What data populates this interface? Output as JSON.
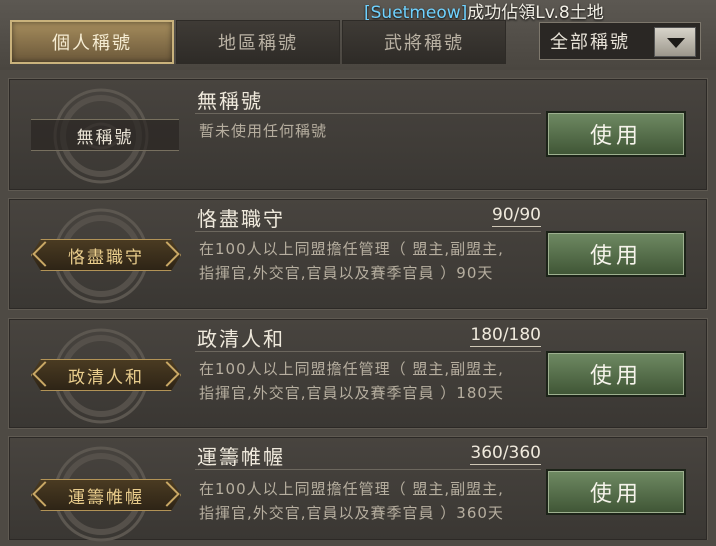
{
  "notice": {
    "user": "[Suetmeow]",
    "message": "成功佔領Lv.8土地"
  },
  "tabs": [
    {
      "label": "個人稱號",
      "active": true
    },
    {
      "label": "地區稱號",
      "active": false
    },
    {
      "label": "武將稱號",
      "active": false
    }
  ],
  "filter": {
    "selected": "全部稱號"
  },
  "titles": [
    {
      "plate": "無稱號",
      "name": "無稱號",
      "progress": "",
      "description": "暫未使用任何稱號",
      "button": "使用"
    },
    {
      "plate": "恪盡職守",
      "name": "恪盡職守",
      "progress": "90/90",
      "description": "在100人以上同盟擔任管理（ 盟主,副盟主,指揮官,外交官,官員以及賽季官員 ）90天",
      "button": "使用"
    },
    {
      "plate": "政清人和",
      "name": "政清人和",
      "progress": "180/180",
      "description": "在100人以上同盟擔任管理（ 盟主,副盟主,指揮官,外交官,官員以及賽季官員 ）180天",
      "button": "使用"
    },
    {
      "plate": "運籌帷幄",
      "name": "運籌帷幄",
      "progress": "360/360",
      "description": "在100人以上同盟擔任管理（ 盟主,副盟主,指揮官,外交官,官員以及賽季官員 ）360天",
      "button": "使用"
    }
  ]
}
